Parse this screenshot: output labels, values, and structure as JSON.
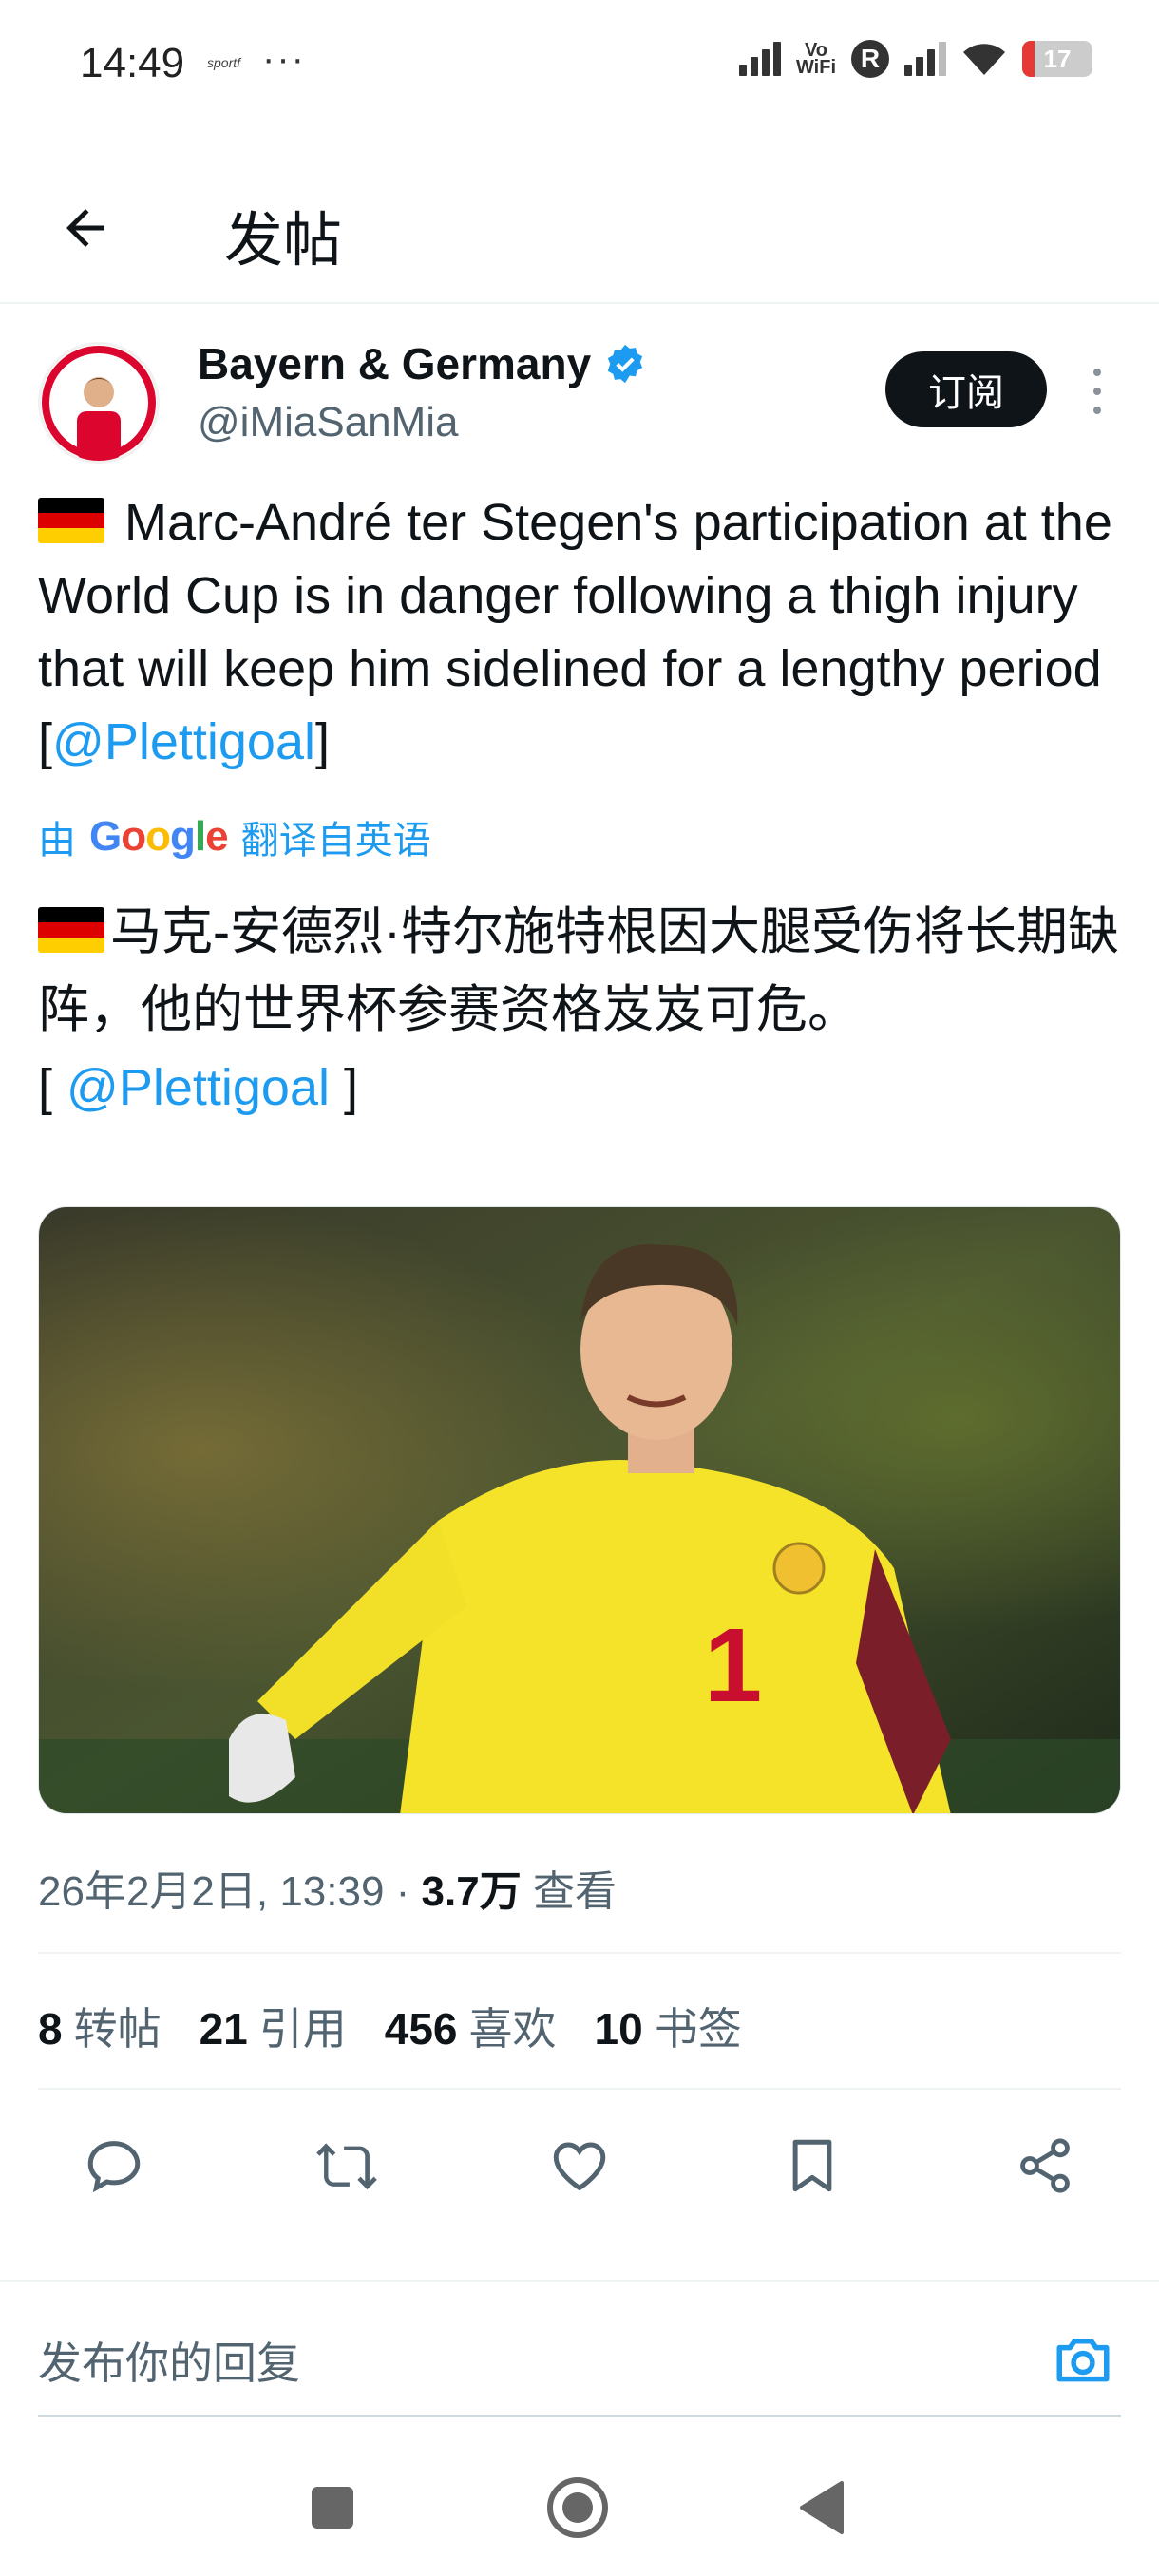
{
  "status_bar": {
    "time": "14:49",
    "app_label": "sportf",
    "dots": "···",
    "vowifi_top": "Vo",
    "vowifi_bottom": "WiFi",
    "roaming_badge": "R",
    "battery_level": "17",
    "battery_fraction": 0.17,
    "battery_color": "#e53935"
  },
  "header": {
    "back_icon": "arrow-left-icon",
    "title": "发帖"
  },
  "author": {
    "name": "Bayern & Germany",
    "handle": "@iMiaSanMia",
    "verified_color": "#1d9bf0",
    "subscribe_label": "订阅"
  },
  "tweet": {
    "text_before": " Marc-André ter Stegen's participation at the World Cup is in danger following a thigh injury that will keep him sidelined for a lengthy period [",
    "mention": "@Plettigoal",
    "text_after": "]",
    "translate_prefix": "由",
    "translate_brand": "Google",
    "translate_suffix": "翻译自英语",
    "translated_text": "马克-安德烈·特尔施特根因大腿受伤将长期缺阵，他的世界杯参赛资格岌岌可危。",
    "translated_mention_open": "[ ",
    "translated_mention": "@Plettigoal",
    "translated_mention_close": " ]",
    "image_icon": "goalkeeper-photo"
  },
  "meta": {
    "datetime": "26年2月2日, 13:39 · ",
    "views_count": "3.7万",
    "views_label": " 查看"
  },
  "stats": [
    {
      "count": "8",
      "label": "转帖"
    },
    {
      "count": "21",
      "label": "引用"
    },
    {
      "count": "456",
      "label": "喜欢"
    },
    {
      "count": "10",
      "label": "书签"
    }
  ],
  "actions": [
    "reply-icon",
    "retweet-icon",
    "like-icon",
    "bookmark-icon",
    "share-icon"
  ],
  "reply": {
    "placeholder": "发布你的回复",
    "camera_icon": "camera-icon",
    "accent_color": "#1d9bf0"
  },
  "nav": [
    "recents-square-icon",
    "home-circle-icon",
    "back-triangle-icon"
  ]
}
